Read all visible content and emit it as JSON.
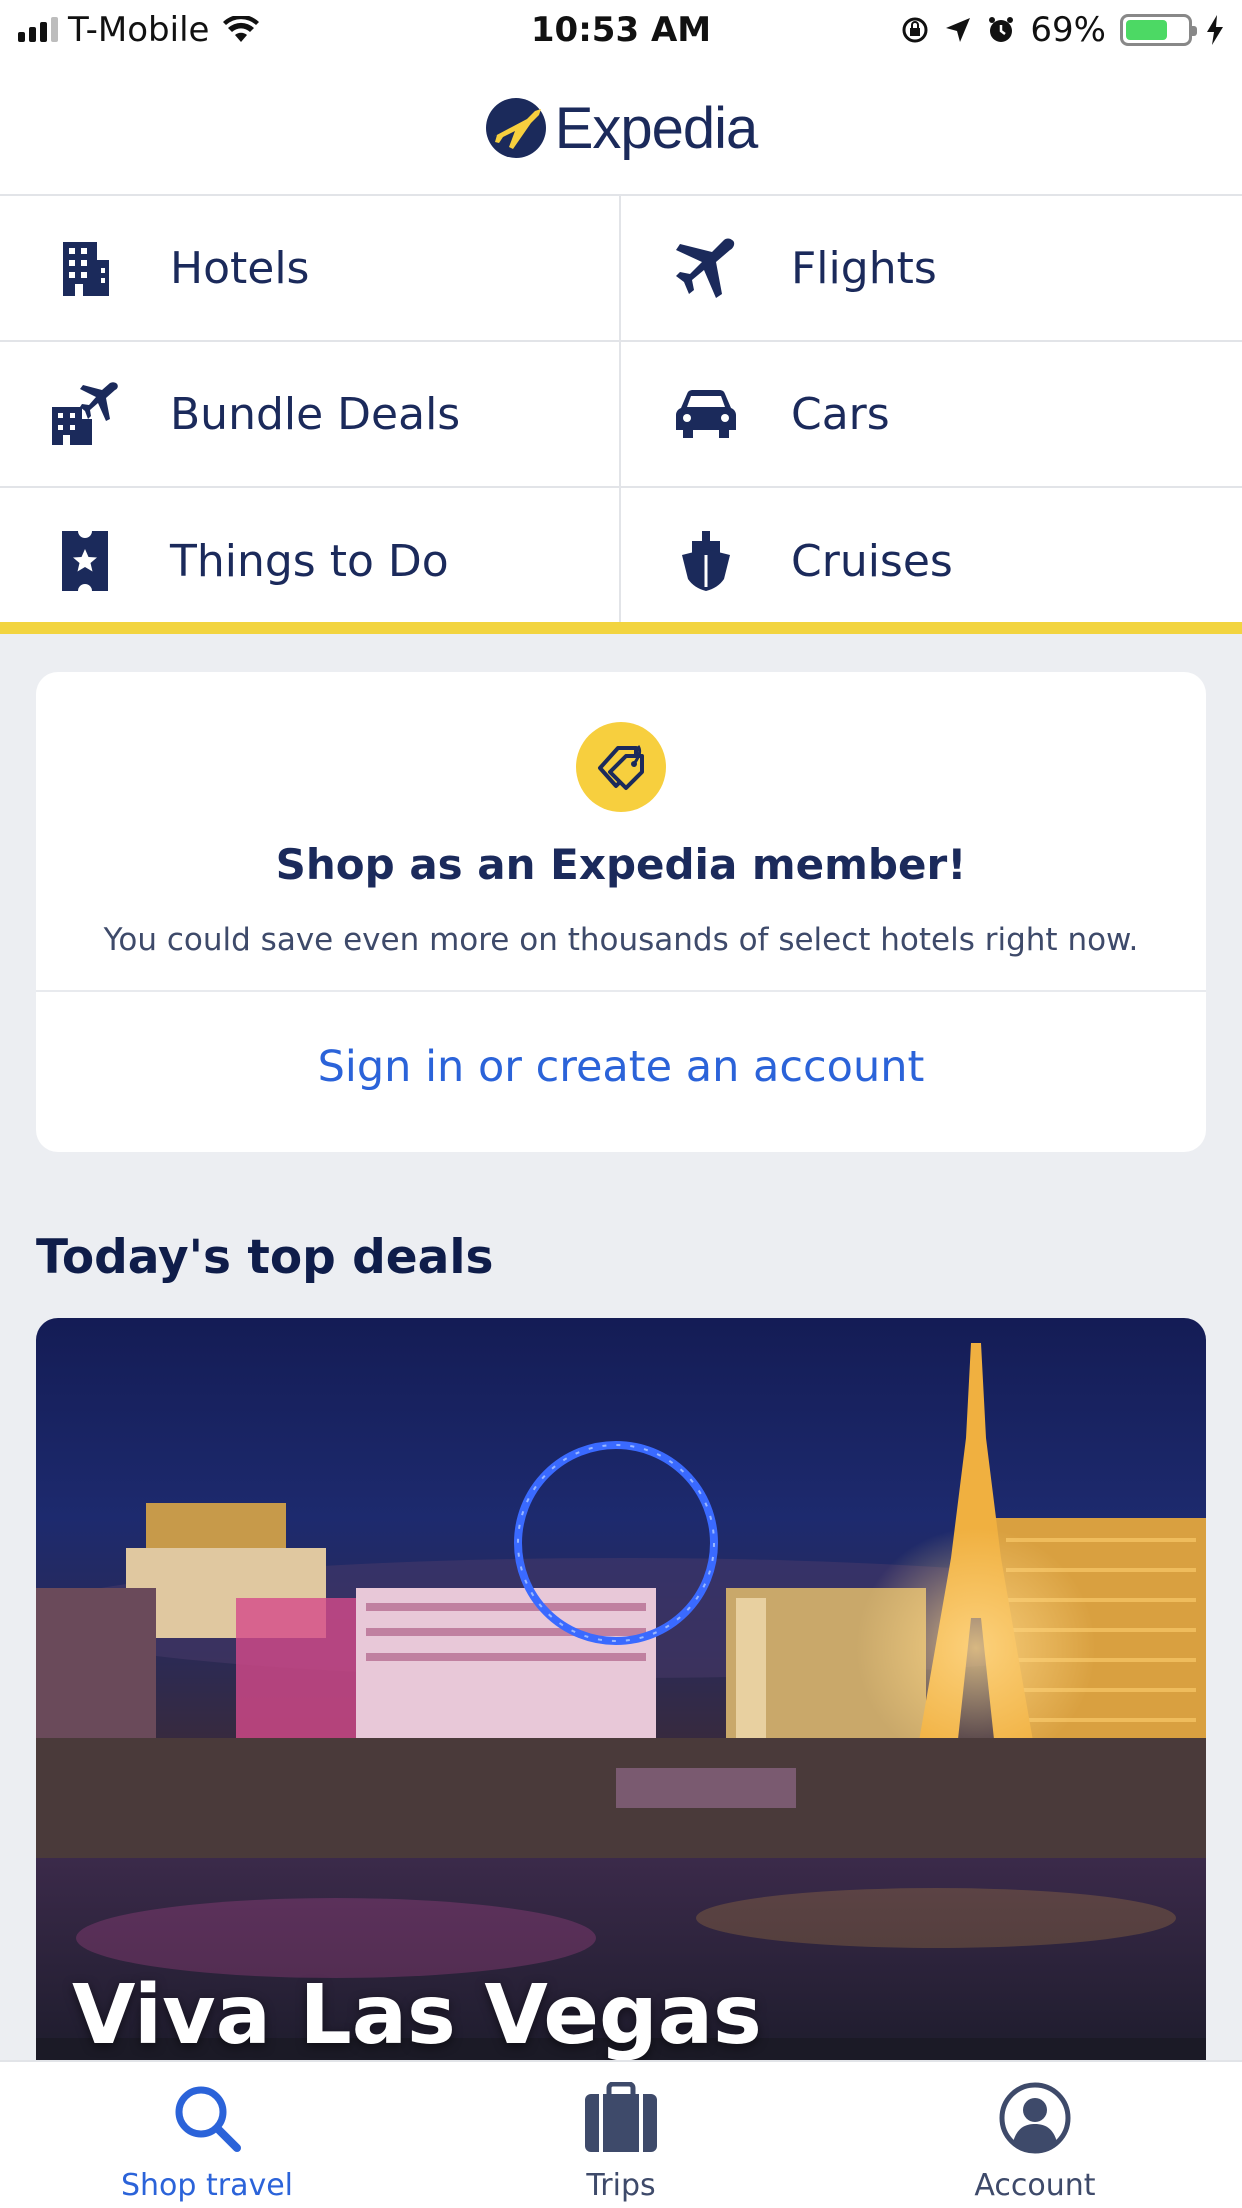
{
  "status_bar": {
    "carrier": "T-Mobile",
    "time": "10:53 AM",
    "battery": "69%",
    "battery_level": 0.69,
    "icons": [
      "signal-icon",
      "wifi-icon",
      "orientation-lock-icon",
      "location-icon",
      "alarm-icon",
      "battery-icon",
      "charging-icon"
    ]
  },
  "header": {
    "logo_text": "Expedia",
    "brand_color": "#1b2a5b",
    "accent_color": "#f7cf3e"
  },
  "categories": [
    {
      "label": "Hotels",
      "icon": "hotel-building-icon"
    },
    {
      "label": "Flights",
      "icon": "airplane-icon"
    },
    {
      "label": "Bundle Deals",
      "icon": "bundle-icon"
    },
    {
      "label": "Cars",
      "icon": "car-icon"
    },
    {
      "label": "Things to Do",
      "icon": "ticket-icon"
    },
    {
      "label": "Cruises",
      "icon": "cruise-ship-icon"
    }
  ],
  "member_card": {
    "icon": "price-tag-icon",
    "title": "Shop as an Expedia member!",
    "subtitle": "You could save even more on thousands of select hotels right now.",
    "link": "Sign in or create an account",
    "link_color": "#2b63d9"
  },
  "deals": {
    "heading": "Today's top deals",
    "cards": [
      {
        "title": "Viva Las Vegas"
      }
    ]
  },
  "tab_bar": {
    "tabs": [
      {
        "label": "Shop travel",
        "icon": "search-icon",
        "active": true
      },
      {
        "label": "Trips",
        "icon": "suitcase-icon",
        "active": false
      },
      {
        "label": "Account",
        "icon": "account-icon",
        "active": false
      }
    ]
  }
}
